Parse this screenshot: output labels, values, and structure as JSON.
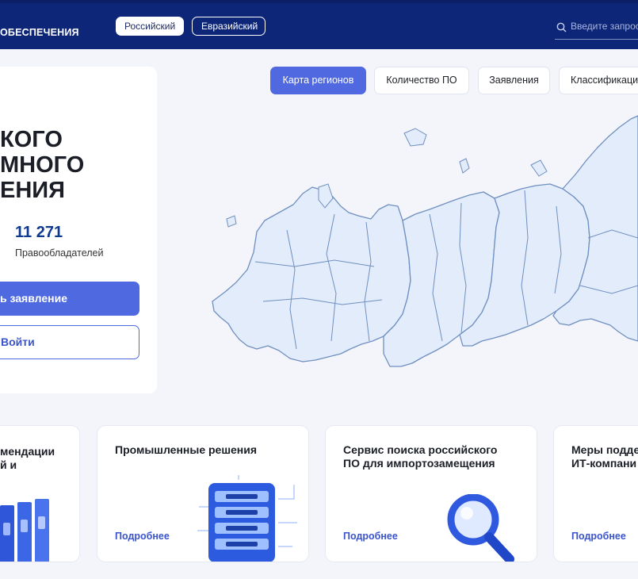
{
  "header": {
    "brand": "ОБЕСПЕЧЕНИЯ",
    "registry_tabs": [
      "Российский",
      "Евразийский"
    ],
    "search_placeholder": "Введите запрос"
  },
  "hero": {
    "title_lines": [
      "КОГО",
      "МНОГО",
      "ЕНИЯ"
    ],
    "stat_value": "11 271",
    "stat_label": "Правообладателей",
    "primary_button": "ь заявление",
    "secondary_button": "Войти"
  },
  "map_tabs": [
    "Карта регионов",
    "Количество ПО",
    "Заявления",
    "Классификация"
  ],
  "cards": [
    {
      "title_lines": [
        "мендации",
        "й и"
      ],
      "link": ""
    },
    {
      "title_lines": [
        "Промышленные решения"
      ],
      "link": "Подробнее"
    },
    {
      "title_lines": [
        "Сервис поиска российского",
        "ПО для импортозамещения"
      ],
      "link": "Подробнее"
    },
    {
      "title_lines": [
        "Меры подде",
        "ИТ-компани"
      ],
      "link": "Подробнее"
    }
  ],
  "colors": {
    "header_bg": "#0d2677",
    "accent": "#5169e0",
    "map_fill": "#e3ecfb",
    "map_stroke": "#6f8fc0"
  },
  "icons": [
    "search-icon",
    "folder-binders-icon",
    "server-icon",
    "magnifier-icon"
  ]
}
